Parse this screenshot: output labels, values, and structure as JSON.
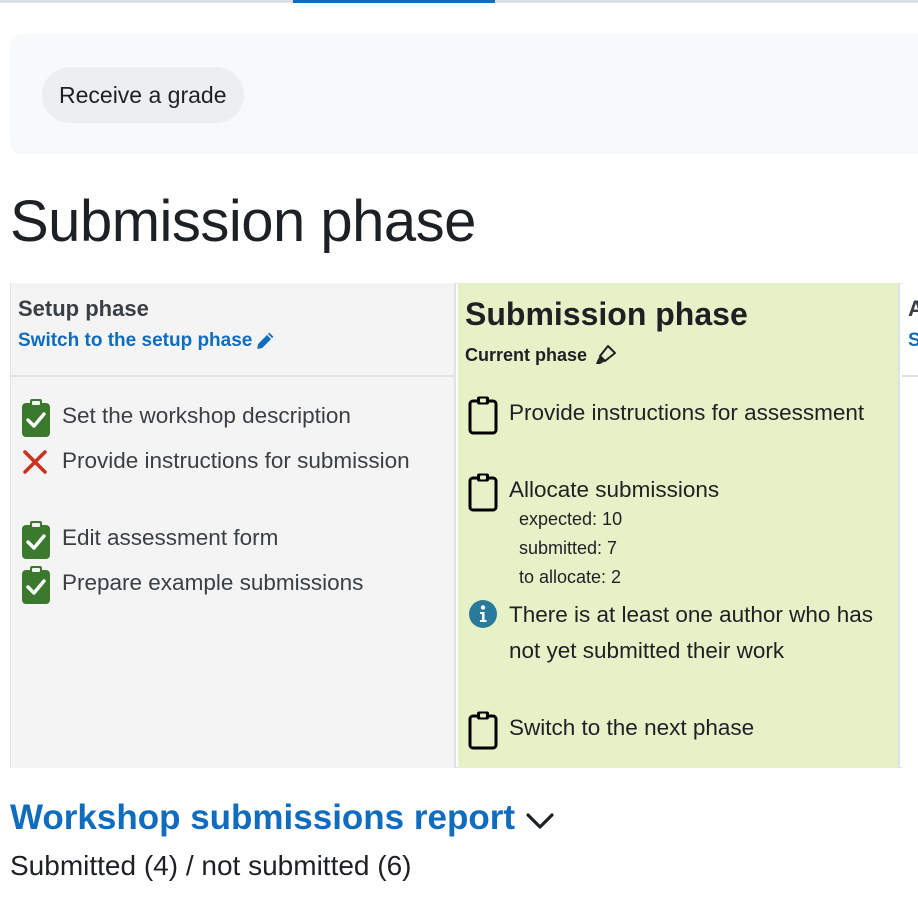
{
  "activity": {
    "receive_grade": "Receive a grade"
  },
  "page_title": "Submission phase",
  "phases": {
    "setup": {
      "name": "Setup phase",
      "switch_link": "Switch to the setup phase",
      "tasks": [
        {
          "label": "Set the workshop description",
          "status": "done",
          "icon": "clipboard-check-icon"
        },
        {
          "label": "Provide instructions for submission",
          "status": "fail",
          "icon": "cross-icon"
        },
        {
          "label": "Edit assessment form",
          "status": "done",
          "icon": "clipboard-check-icon"
        },
        {
          "label": "Prepare example submissions",
          "status": "done",
          "icon": "clipboard-check-icon"
        }
      ]
    },
    "submission": {
      "name": "Submission phase",
      "current_label": "Current phase",
      "tasks": [
        {
          "label": "Provide instructions for assessment",
          "icon": "clipboard-icon"
        },
        {
          "label": "Allocate submissions",
          "icon": "clipboard-icon",
          "details": [
            "expected: 10",
            "submitted: 7",
            "to allocate: 2"
          ]
        },
        {
          "label": "There is at least one author who has not yet submitted their work",
          "icon": "info-icon"
        },
        {
          "label": "Switch to the next phase",
          "icon": "clipboard-icon"
        }
      ]
    },
    "assessment": {
      "name_partial": "A",
      "link_partial": "S"
    }
  },
  "report": {
    "title": "Workshop submissions report",
    "summary": "Submitted (4) / not submitted (6)"
  },
  "colors": {
    "link": "#0f6cbf",
    "done_green": "#3b7a2e",
    "fail_red": "#ca3120",
    "info_teal": "#2a7a9b",
    "current_phase_bg": "#e7f1c7"
  }
}
